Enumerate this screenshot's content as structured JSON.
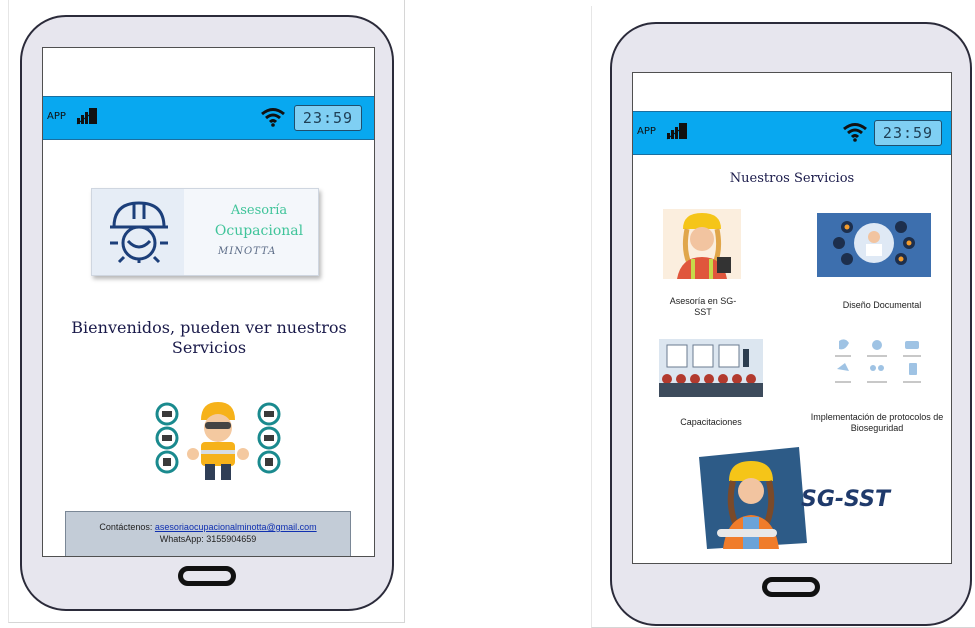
{
  "colors": {
    "statusbar": "#08a8f0",
    "phone_body": "#e7e6ee",
    "contact_bg": "#c3ccd7",
    "logo_green": "#40c49a",
    "title_navy": "#1a1a4a"
  },
  "left_phone": {
    "status": {
      "app_label": "APP",
      "clock": "23:59",
      "icons": [
        "signal-icon",
        "wifi-icon"
      ]
    },
    "logo": {
      "line1": "Asesoría",
      "line2": "Ocupacional",
      "line3": "MINOTTA",
      "icon": "helmet-gear-icon"
    },
    "welcome_text": "Bienvenidos, pueden ver nuestros Servicios",
    "illustration": "safety-worker-equipment-icon",
    "contact": {
      "label": "Contáctenos:",
      "email": "asesoriaocupacionalminotta@gmail.com",
      "whatsapp": "WhatsApp: 3155904659"
    }
  },
  "right_phone": {
    "status": {
      "app_label": "APP",
      "clock": "23:59",
      "icons": [
        "signal-icon",
        "wifi-icon"
      ]
    },
    "title": "Nuestros Servicios",
    "services": [
      {
        "label": "Asesoría en SG-SST",
        "icon": "worker-woman-icon"
      },
      {
        "label": "Diseño Documental",
        "icon": "document-design-icon"
      },
      {
        "label": "Capacitaciones",
        "icon": "training-icon"
      },
      {
        "label": "Implementación de protocolos de Bioseguridad",
        "icon": "biosafety-icon"
      }
    ],
    "banner": {
      "text": "SG-SST",
      "icon": "engineer-woman-icon"
    }
  }
}
